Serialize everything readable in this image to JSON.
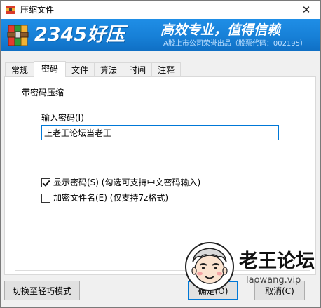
{
  "window": {
    "title": "压缩文件",
    "close_glyph": "✕"
  },
  "banner": {
    "brand": "2345好压",
    "slogan": "高效专业，值得信赖",
    "subtitle": "A股上市公司荣誉出品（股票代码：002195）",
    "logo_icon": "archive-books-icon",
    "accent_color": "#1780d7"
  },
  "tabs": [
    {
      "label": "常规",
      "active": false
    },
    {
      "label": "密码",
      "active": true
    },
    {
      "label": "文件",
      "active": false
    },
    {
      "label": "算法",
      "active": false
    },
    {
      "label": "时间",
      "active": false
    },
    {
      "label": "注释",
      "active": false
    }
  ],
  "password_group": {
    "title": "带密码压缩",
    "input_label": "输入密码(I)",
    "input_value": "上老王论坛当老王",
    "show_password": {
      "label": "显示密码(S)  (勾选可支持中文密码输入)",
      "checked": true
    },
    "encrypt_filenames": {
      "label": "加密文件名(E)  (仅支持7z格式)",
      "checked": false
    }
  },
  "buttons": {
    "mode": "切换至轻巧模式",
    "ok": "确定(O)",
    "cancel": "取消(C)"
  },
  "watermark": {
    "title": "老王论坛",
    "url": "laowang.vip",
    "avatar_icon": "old-man-avatar-icon"
  }
}
